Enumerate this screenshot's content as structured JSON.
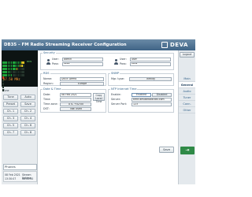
{
  "window": {
    "title": "DB35 – FM Radio Streaming Receiver Configuration",
    "brand": "DEVA"
  },
  "meter": {
    "rows": [
      "L",
      "R",
      "MPX",
      "RDS",
      "PILOT"
    ],
    "rds": "RDS",
    "freq": "87.50 MHz"
  },
  "tune": {
    "label": "Tune"
  },
  "left_buttons": [
    {
      "id": "a",
      "label": "Tune"
    },
    {
      "id": "b",
      "label": "Auto"
    },
    {
      "id": "c",
      "label": "Preset"
    },
    {
      "id": "d",
      "label": "Save"
    },
    {
      "id": "e",
      "label": "Ch. 1"
    },
    {
      "id": "f",
      "label": "Ch. 2"
    },
    {
      "id": "g",
      "label": "Ch. 3"
    },
    {
      "id": "h",
      "label": "Ch. 4"
    },
    {
      "id": "i",
      "label": "Ch. 5"
    },
    {
      "id": "j",
      "label": "Ch. 6"
    },
    {
      "id": "k",
      "label": "Ch. 7"
    },
    {
      "id": "l",
      "label": "Ch. 8"
    }
  ],
  "phones": {
    "label": "Phones"
  },
  "status": {
    "date": "08 Feb 2021",
    "time": "13:30:07",
    "uptime_label": "Stream Uptime",
    "uptime_value": "00:00:00"
  },
  "security": {
    "legend": "Security",
    "user1_label": "User:",
    "user1_value": "admin",
    "pass1_label": "Pass:",
    "pass1_value": "••••",
    "user2_label": "User:",
    "user2_value": "user",
    "pass2_label": "Pass:",
    "pass2_value": "••••"
  },
  "rds": {
    "legend": "RDS",
    "name_label": "Name:",
    "name_value": "DB35 Demo",
    "region_label": "Region:",
    "region_value": "Europe"
  },
  "snmp": {
    "legend": "SNMP",
    "mgr_label": "Mgr. type:",
    "mgr_value": "Infinity"
  },
  "date_time": {
    "legend": "Date & Time",
    "date_label": "Date:",
    "date_value": "08 Feb 2021",
    "copy_button": "Copy Local Time",
    "time_label": "Time:",
    "timezone_label": "Time zone:",
    "timezone_value": "UTC +02:00",
    "dst_label": "DST:",
    "dst_value": "Not Used"
  },
  "ntp": {
    "legend": "NTP Internet Time",
    "enable_label": "Enable:",
    "enabled_label": "Enabled",
    "disabled_label": "Disabled",
    "server_label": "Server:",
    "server_value": "time.devabroadcast.com",
    "port_label": "Server Port:",
    "port_value": "123"
  },
  "save_button": "Save",
  "right_menu": {
    "logout": "Logout",
    "items": [
      "Main",
      "General",
      "Audio",
      "Tuner",
      "Conn.",
      "Other"
    ],
    "active": "General"
  }
}
